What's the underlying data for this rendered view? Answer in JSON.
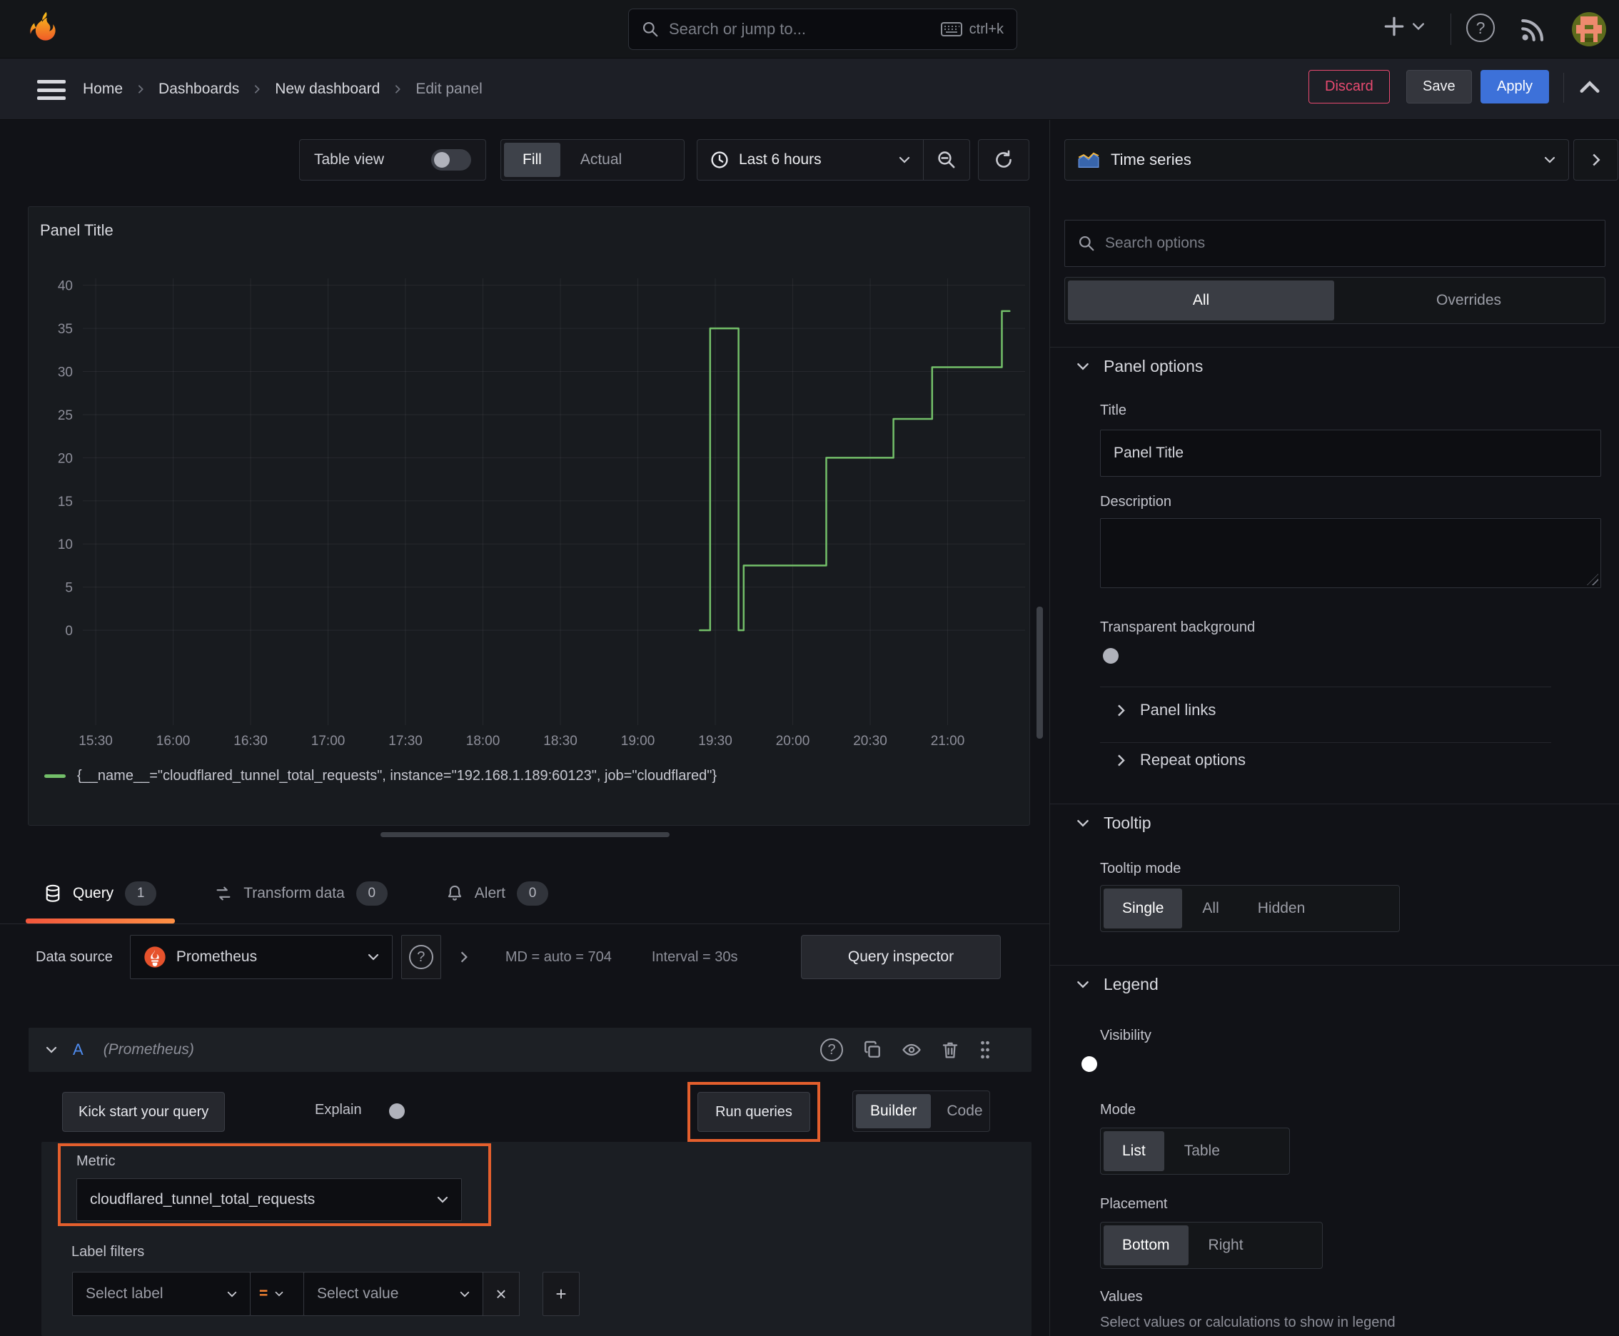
{
  "topbar": {
    "search_placeholder": "Search or jump to...",
    "shortcut": "ctrl+k"
  },
  "nav": {
    "breadcrumbs": [
      "Home",
      "Dashboards",
      "New dashboard",
      "Edit panel"
    ],
    "discard": "Discard",
    "save": "Save",
    "apply": "Apply"
  },
  "toolbar": {
    "table_view": "Table view",
    "fill": "Fill",
    "actual": "Actual",
    "time_range": "Last 6 hours"
  },
  "panel": {
    "title": "Panel Title"
  },
  "chart_data": {
    "type": "line",
    "title": "Panel Title",
    "x_ticks": [
      "15:30",
      "16:00",
      "16:30",
      "17:00",
      "17:30",
      "18:00",
      "18:30",
      "19:00",
      "19:30",
      "20:00",
      "20:30",
      "21:00"
    ],
    "y_ticks": [
      0,
      5,
      10,
      15,
      20,
      25,
      30,
      35,
      40
    ],
    "x_axis_minutes_range": [
      925,
      1290
    ],
    "y_axis_range": [
      -11,
      40.8
    ],
    "ylim": [
      0,
      40
    ],
    "grid": true,
    "legend_position": "bottom",
    "series": [
      {
        "name": "{__name__=\"cloudflared_tunnel_total_requests\", instance=\"192.168.1.189:60123\", job=\"cloudflared\"}",
        "color": "#73bf69",
        "points_time_value": [
          [
            "19:24",
            0
          ],
          [
            "19:28",
            0
          ],
          [
            "19:28",
            35
          ],
          [
            "19:39",
            35
          ],
          [
            "19:39",
            0
          ],
          [
            "19:41",
            0
          ],
          [
            "19:41",
            7.5
          ],
          [
            "20:13",
            7.5
          ],
          [
            "20:13",
            20
          ],
          [
            "20:39",
            20
          ],
          [
            "20:39",
            24.5
          ],
          [
            "20:54",
            24.5
          ],
          [
            "20:54",
            30.5
          ],
          [
            "21:21",
            30.5
          ],
          [
            "21:21",
            37
          ],
          [
            "21:24",
            37
          ]
        ]
      }
    ]
  },
  "query": {
    "tabs": [
      {
        "label": "Query",
        "badge": "1"
      },
      {
        "label": "Transform data",
        "badge": "0"
      },
      {
        "label": "Alert",
        "badge": "0"
      }
    ],
    "datasource_label": "Data source",
    "datasource_name": "Prometheus",
    "stats_md": "MD = auto = 704",
    "stats_interval": "Interval = 30s",
    "inspector": "Query inspector",
    "ref_id": "A",
    "ref_hint": "(Prometheus)",
    "kick_start": "Kick start your query",
    "explain": "Explain",
    "run_queries": "Run queries",
    "builder": "Builder",
    "code": "Code",
    "metric_label": "Metric",
    "metric_value": "cloudflared_tunnel_total_requests",
    "label_filters": "Label filters",
    "select_label_placeholder": "Select label",
    "operator": "=",
    "select_value_placeholder": "Select value"
  },
  "sidebar": {
    "visualization": "Time series",
    "search_placeholder": "Search options",
    "tab_all": "All",
    "tab_overrides": "Overrides",
    "panel_options": {
      "header": "Panel options",
      "title_label": "Title",
      "title_value": "Panel Title",
      "description_label": "Description",
      "transparent": "Transparent background"
    },
    "panel_links": "Panel links",
    "repeat_options": "Repeat options",
    "tooltip": {
      "header": "Tooltip",
      "mode_label": "Tooltip mode",
      "options": [
        "Single",
        "All",
        "Hidden"
      ],
      "selected": "Single"
    },
    "legend": {
      "header": "Legend",
      "visibility": "Visibility",
      "mode_label": "Mode",
      "mode_options": [
        "List",
        "Table"
      ],
      "mode_selected": "List",
      "placement_label": "Placement",
      "placement_options": [
        "Bottom",
        "Right"
      ],
      "placement_selected": "Bottom",
      "values_label": "Values",
      "values_desc": "Select values or calculations to show in legend"
    }
  },
  "icons": {
    "question": "?",
    "plus": "+",
    "times": "×"
  },
  "colors": {
    "accent_orange": "#e45f2d",
    "tab_underline_from": "#f2563c",
    "tab_underline_to": "#ff9044",
    "series_green": "#73bf69",
    "apply_blue": "#3d71d9",
    "discard_pink": "#e84a70",
    "toggle_on_blue": "#3d71d9"
  }
}
